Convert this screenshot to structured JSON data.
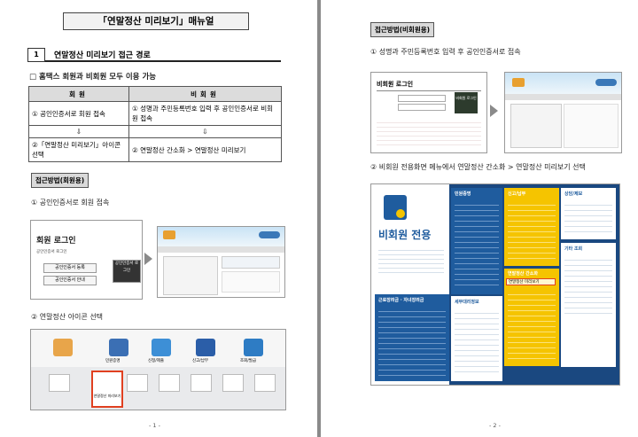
{
  "page1": {
    "title": "「연말정산 미리보기」매뉴얼",
    "section_number": "1",
    "section_title": "연말정산 미리보기 접근 경로",
    "subtitle": "□ 홈택스 회원과 비회원 모두 이용 가능",
    "table": {
      "headers": [
        "회원",
        "비회원"
      ],
      "row1": [
        "① 공인인증서로 회원 접속",
        "① 성명과 주민등록번호 입력 후 공인인증서로 비회원 접속"
      ],
      "arrow": "⇩",
      "row3": [
        "②「연말정산 미리보기」아이콘 선택",
        "② 연말정산 간소화 > 연말정산 미리보기"
      ]
    },
    "member_tag": "접근방법(회원용)",
    "step1": "① 공인인증서로 회원 접속",
    "login_title": "회원 로그인",
    "login_caption": "공인인증서 로그인",
    "login_btn1": "공인인증서 등록",
    "login_btn2": "공인인증서 안내",
    "login_btn3": "공인인증서 로그인",
    "step2": "② 연말정산 아이콘 선택",
    "icon_labels": [
      "",
      "민원증명",
      "신청/제출",
      "신고/납부",
      "조회/발급"
    ],
    "bottom_icon_labels": [
      "",
      "연말정산 미리보기",
      "",
      "",
      "",
      "",
      ""
    ],
    "page_num": "- 1 -"
  },
  "page2": {
    "nonmember_tag": "접근방법(비회원용)",
    "step1": "① 성명과 주민등록번호 입력 후 공인인증서로 접속",
    "login_title": "비회원 로그인",
    "login_btn": "비회원 로그인",
    "step2": "② 비회원 전용화면 메뉴에서 연말정산 간소화 > 연말정산 미리보기 선택",
    "big_title": "비회원 전용",
    "menu_left_title": "민원증명",
    "menu_mid_title": "신고/납부",
    "menu_right_title": "상담/제보",
    "menu_right2_title": "기타 조회",
    "menu_bottom_left": "근로장려금 · 자녀장려금",
    "menu_bottom_mid": "세무대리정보",
    "menu_yearend": "연말정산 간소화",
    "menu_preview": "연말정산 미리보기",
    "page_num": "- 2 -"
  },
  "colors": {
    "tag_bg": "#d9d9d9",
    "menu_blue": "#1f5c9e",
    "menu_yellow": "#f5c400",
    "highlight_red": "#e04020"
  }
}
